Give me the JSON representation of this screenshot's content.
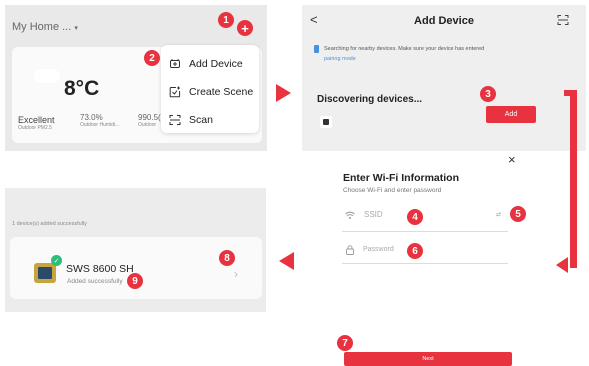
{
  "panel_home": {
    "title": "My Home",
    "title_suffix": "...",
    "temperature": "8°C",
    "stats": [
      {
        "value": "Excellent",
        "label": "Outdoor PM2.5"
      },
      {
        "value": "73.0%",
        "label": "Outdoor Humidi..."
      },
      {
        "value": "990.5(",
        "label": "Outdoor"
      }
    ],
    "menu": [
      {
        "label": "Add Device",
        "icon": "add-device-icon"
      },
      {
        "label": "Create Scene",
        "icon": "create-scene-icon"
      },
      {
        "label": "Scan",
        "icon": "scan-icon"
      }
    ]
  },
  "panel_add_device": {
    "back": "<",
    "title": "Add Device",
    "notice": "Searching for nearby devices. Make sure your device has entered",
    "notice_link": "pairing mode",
    "discovering": "Discovering devices...",
    "add_button": "Add"
  },
  "panel_wifi": {
    "close": "×",
    "title": "Enter Wi-Fi Information",
    "subtitle": "Choose Wi-Fi and enter password",
    "ssid_placeholder": "SSID",
    "password_placeholder": "Password",
    "next_button": "Next"
  },
  "panel_result": {
    "success_text": "1 device(s) added successfully",
    "device_name": "SWS 8600 SH",
    "device_status": "Added successfully"
  },
  "badges": [
    "1",
    "2",
    "3",
    "4",
    "5",
    "6",
    "7",
    "8",
    "9"
  ],
  "colors": {
    "accent": "#e8323f",
    "panel_bg": "#ececec",
    "success_green": "#2bbf7a"
  }
}
